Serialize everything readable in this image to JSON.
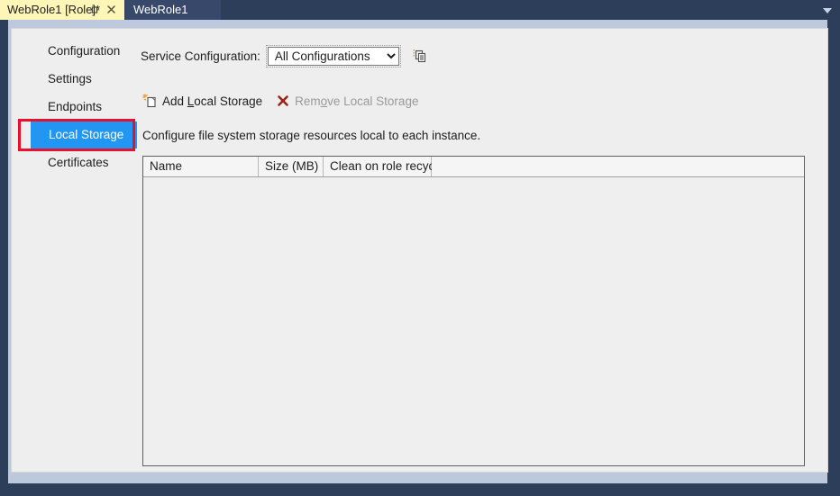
{
  "window": {
    "tabs": [
      {
        "label": "WebRole1 [Role]*",
        "active": true,
        "pin_icon": "pin-icon",
        "close_icon": "close-icon"
      },
      {
        "label": "WebRole1",
        "active": false
      }
    ],
    "overflow_icon": "chevron-down-icon"
  },
  "sidebar": {
    "items": [
      {
        "label": "Configuration",
        "selected": false
      },
      {
        "label": "Settings",
        "selected": false
      },
      {
        "label": "Endpoints",
        "selected": false
      },
      {
        "label": "Local Storage",
        "selected": true
      },
      {
        "label": "Certificates",
        "selected": false
      }
    ],
    "highlight_color": "#e8112d",
    "selection_color": "#2196f3"
  },
  "service_configuration": {
    "label_pre": "Service Confi",
    "label_accel": "g",
    "label_post": "uration:",
    "selected": "All Configurations",
    "options": [
      "All Configurations"
    ],
    "copy_icon": "copy-configuration-icon"
  },
  "toolbar": {
    "add": {
      "pre": "Add ",
      "accel": "L",
      "post": "ocal Storage",
      "icon": "add-local-storage-icon",
      "enabled": true
    },
    "remove": {
      "pre": "Rem",
      "accel": "o",
      "post": "ve Local Storage",
      "icon": "remove-local-storage-icon",
      "enabled": false
    }
  },
  "description": "Configure file system storage resources local to each instance.",
  "grid": {
    "columns": [
      "Name",
      "Size (MB)",
      "Clean on role recycle"
    ],
    "rows": []
  }
}
